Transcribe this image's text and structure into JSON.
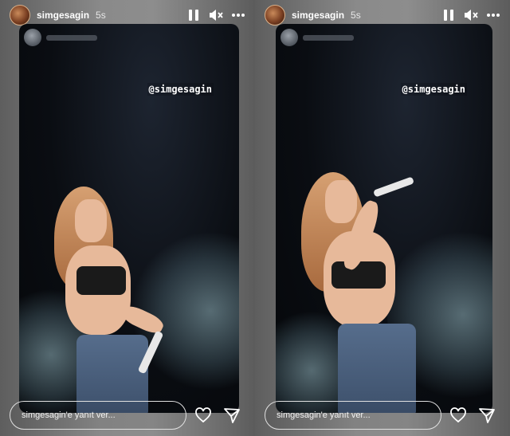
{
  "stories": [
    {
      "username": "simgesagin",
      "time": "5s",
      "mention": "@simgesagin",
      "reply_placeholder": "simgesagin'e yanıt ver..."
    },
    {
      "username": "simgesagin",
      "time": "5s",
      "mention": "@simgesagin",
      "reply_placeholder": "simgesagin'e yanıt ver..."
    }
  ],
  "icons": {
    "pause": "pause-icon",
    "mute": "speaker-muted-icon",
    "more": "more-dots-icon",
    "like": "heart-icon",
    "share": "send-icon"
  },
  "colors": {
    "text": "#ffffff",
    "background": "#6f6f6f",
    "story_bg": "#0a0d12"
  }
}
